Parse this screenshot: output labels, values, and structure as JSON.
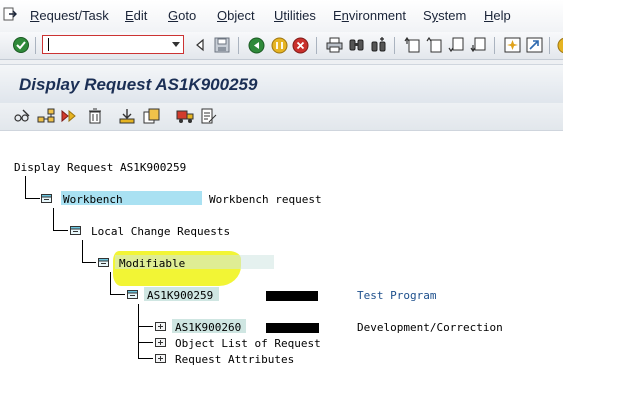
{
  "menu": {
    "items": [
      {
        "label": "Request/Task",
        "underline": "R"
      },
      {
        "label": "Edit",
        "underline": "E"
      },
      {
        "label": "Goto",
        "underline": "G"
      },
      {
        "label": "Object",
        "underline": "O"
      },
      {
        "label": "Utilities",
        "underline": "U"
      },
      {
        "label": "Environment",
        "underline": "n"
      },
      {
        "label": "System",
        "underline": "y"
      },
      {
        "label": "Help",
        "underline": "H"
      }
    ]
  },
  "command_field": {
    "value": ""
  },
  "title": "Display Request AS1K900259",
  "tree": {
    "root": "Display Request AS1K900259",
    "workbench": {
      "label": "Workbench",
      "desc": "Workbench request"
    },
    "local": {
      "label": "Local Change Requests"
    },
    "modifiable": {
      "label": "Modifiable"
    },
    "request": {
      "label": "AS1K900259",
      "desc": "Test Program"
    },
    "task": {
      "label": "AS1K900260",
      "desc": "Development/Correction"
    },
    "object_list": {
      "label": "Object List of Request"
    },
    "attributes": {
      "label": "Request Attributes"
    }
  },
  "colors": {
    "highlight_blue": "#a9e1f2",
    "highlight_green": "#cfe6e2",
    "annotation_yellow": "#f1f41f",
    "title_text": "#1b2f55",
    "desc_blue": "#1d4f8c"
  }
}
